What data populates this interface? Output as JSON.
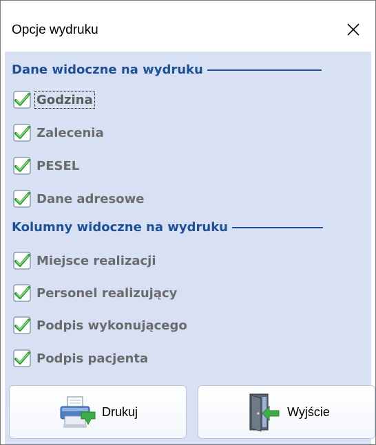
{
  "window": {
    "title": "Opcje wydruku",
    "close_icon": "close-icon"
  },
  "sections": [
    {
      "header": "Dane widoczne na wydruku",
      "items": [
        {
          "label": "Godzina",
          "checked": true,
          "focused": true
        },
        {
          "label": "Zalecenia",
          "checked": true
        },
        {
          "label": "PESEL",
          "checked": true
        },
        {
          "label": "Dane adresowe",
          "checked": true
        }
      ]
    },
    {
      "header": "Kolumny widoczne na wydruku",
      "items": [
        {
          "label": "Miejsce realizacji",
          "checked": true
        },
        {
          "label": "Personel realizujący",
          "checked": true
        },
        {
          "label": "Podpis wykonującego",
          "checked": true
        },
        {
          "label": "Podpis pacjenta",
          "checked": true
        }
      ]
    }
  ],
  "buttons": {
    "print": {
      "label": "Drukuj",
      "icon": "printer-icon"
    },
    "exit": {
      "label": "Wyjście",
      "icon": "exit-door-icon"
    }
  },
  "colors": {
    "panel_background": "#d7e1f3",
    "section_header": "#1f4f95",
    "label_text": "#6b6b6b",
    "check_green": "#2e9e3a"
  }
}
